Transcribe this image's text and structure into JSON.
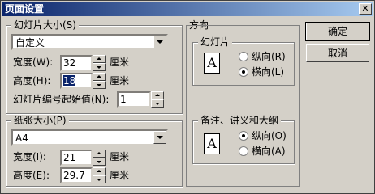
{
  "window": {
    "title": "页面设置",
    "close_label": "✕"
  },
  "slide_size": {
    "group_label": "幻灯片大小(S)",
    "preset_value": "自定义",
    "width_label": "宽度(W):",
    "width_value": "32",
    "width_unit": "厘米",
    "height_label": "高度(H):",
    "height_value": "18",
    "height_unit": "厘米",
    "start_number_label": "幻灯片编号起始值(N):",
    "start_number_value": "1"
  },
  "paper_size": {
    "group_label": "纸张大小(P)",
    "preset_value": "A4",
    "width_label": "宽度(I):",
    "width_value": "21",
    "width_unit": "厘米",
    "height_label": "高度(E):",
    "height_value": "29.7",
    "height_unit": "厘米"
  },
  "orientation": {
    "group_label": "方向",
    "slides": {
      "group_label": "幻灯片",
      "icon_letter": "A",
      "portrait_label": "纵向(R)",
      "landscape_label": "横向(L)",
      "selected": "landscape"
    },
    "notes": {
      "group_label": "备注、讲义和大纲",
      "icon_letter": "A",
      "portrait_label": "纵向(O)",
      "landscape_label": "横向(A)",
      "selected": "portrait"
    }
  },
  "buttons": {
    "ok_label": "确定",
    "cancel_label": "取消"
  }
}
